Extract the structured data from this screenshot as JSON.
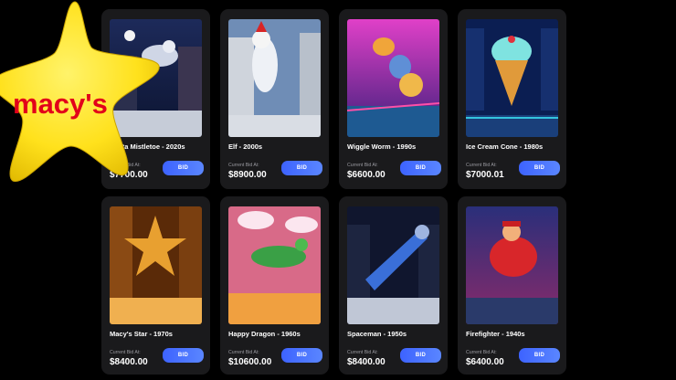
{
  "bid_label": "BID",
  "current_bid_label": "Current Bid At:",
  "logo_text": "macy's",
  "items": [
    {
      "title": "Santa Mistletoe - 2020s",
      "price": "$7700.00"
    },
    {
      "title": "Elf - 2000s",
      "price": "$8900.00"
    },
    {
      "title": "Wiggle Worm - 1990s",
      "price": "$6600.00"
    },
    {
      "title": "Ice Cream Cone - 1980s",
      "price": "$7000.01"
    },
    {
      "title": "Macy's Star - 1970s",
      "price": "$8400.00"
    },
    {
      "title": "Happy Dragon - 1960s",
      "price": "$10600.00"
    },
    {
      "title": "Spaceman - 1950s",
      "price": "$8400.00"
    },
    {
      "title": "Firefighter - 1940s",
      "price": "$6400.00"
    }
  ],
  "colors": {
    "bid_button": "#4a74ff",
    "card_bg": "#1a1a1c",
    "logo_star": "#ffe11c",
    "logo_text": "#e2001a"
  }
}
